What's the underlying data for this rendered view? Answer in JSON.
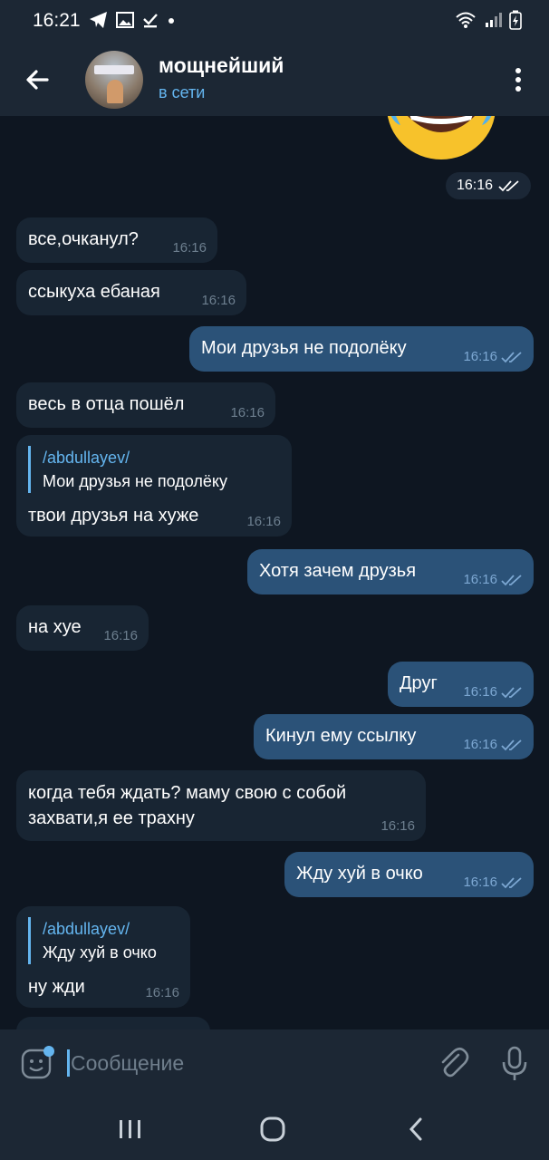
{
  "status_bar": {
    "time": "16:21"
  },
  "header": {
    "title": "мощнейший",
    "status": "в сети"
  },
  "sticker": {
    "time": "16:16"
  },
  "messages": [
    {
      "dir": "in",
      "text": "все,очканул?",
      "time": "16:16"
    },
    {
      "dir": "in",
      "text": "ссыкуха ебаная",
      "time": "16:16"
    },
    {
      "dir": "out",
      "text": "Мои друзья не подолёку",
      "time": "16:16"
    },
    {
      "dir": "in",
      "text": "весь в отца пошёл",
      "time": "16:16"
    },
    {
      "dir": "in",
      "reply_name": "/abdullayev/",
      "reply_text": "Мои друзья не подолёку",
      "text": "твои друзья на хуже",
      "time": "16:16"
    },
    {
      "dir": "out",
      "text": "Хотя зачем друзья",
      "time": "16:16"
    },
    {
      "dir": "in",
      "text": "на хуе",
      "time": "16:16"
    },
    {
      "dir": "out",
      "text": "Друг",
      "time": "16:16"
    },
    {
      "dir": "out",
      "text": "Кинул ему ссылку",
      "time": "16:16"
    },
    {
      "dir": "in",
      "text": "когда тебя ждать? маму свою с собой\nзахвати,я ее трахну",
      "time": "16:16"
    },
    {
      "dir": "out",
      "text": "Жду хуй в очко",
      "time": "16:16"
    },
    {
      "dir": "in",
      "reply_name": "/abdullayev/",
      "reply_text": "Жду хуй в очко",
      "text": "ну жди",
      "time": "16:16"
    }
  ],
  "input": {
    "placeholder": "Сообщение"
  },
  "colors": {
    "bg": "#0e1621",
    "bubble_in": "#182533",
    "bubble_out": "#2b5278",
    "accent": "#64b5ef"
  }
}
